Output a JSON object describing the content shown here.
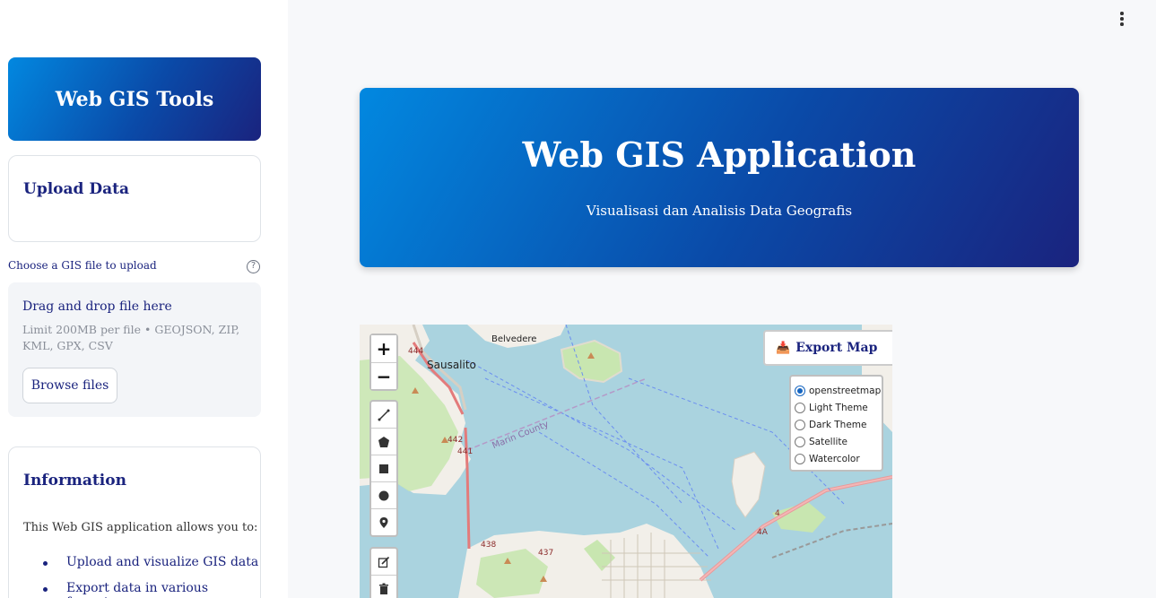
{
  "sidebar": {
    "brand_title": "Web GIS Tools",
    "upload": {
      "title": "Upload Data",
      "file_label": "Choose a GIS file to upload",
      "help_glyph": "?",
      "dropzone_title": "Drag and drop file here",
      "dropzone_limit": "Limit 200MB per file • GEOJSON, ZIP, KML, GPX, CSV",
      "browse_label": "Browse files"
    },
    "information": {
      "title": "Information",
      "intro": "This Web GIS application allows you to:",
      "items": [
        "Upload and visualize GIS data",
        "Export data in various formats"
      ]
    }
  },
  "header": {
    "title": "Web GIS Application",
    "subtitle": "Visualisasi dan Analisis Data Geografis"
  },
  "map": {
    "zoom_in": "+",
    "zoom_out": "−",
    "export_label": "Export Map",
    "layers": [
      {
        "label": "openstreetmap",
        "selected": true
      },
      {
        "label": "Light Theme",
        "selected": false
      },
      {
        "label": "Dark Theme",
        "selected": false
      },
      {
        "label": "Satellite",
        "selected": false
      },
      {
        "label": "Watercolor",
        "selected": false
      }
    ],
    "labels": {
      "sausalito": "Sausalito",
      "belvedere": "Belvedere",
      "marin_county": "Marin County",
      "road_444": "444",
      "road_442": "442",
      "road_441": "441",
      "road_438": "438",
      "road_437": "437",
      "road_4": "4",
      "road_4a": "4A"
    }
  },
  "colors": {
    "brand_start": "#0288e0",
    "brand_end": "#1a237e",
    "water": "#aad3df",
    "land": "#f2efe9",
    "park": "#c8e6b0"
  }
}
